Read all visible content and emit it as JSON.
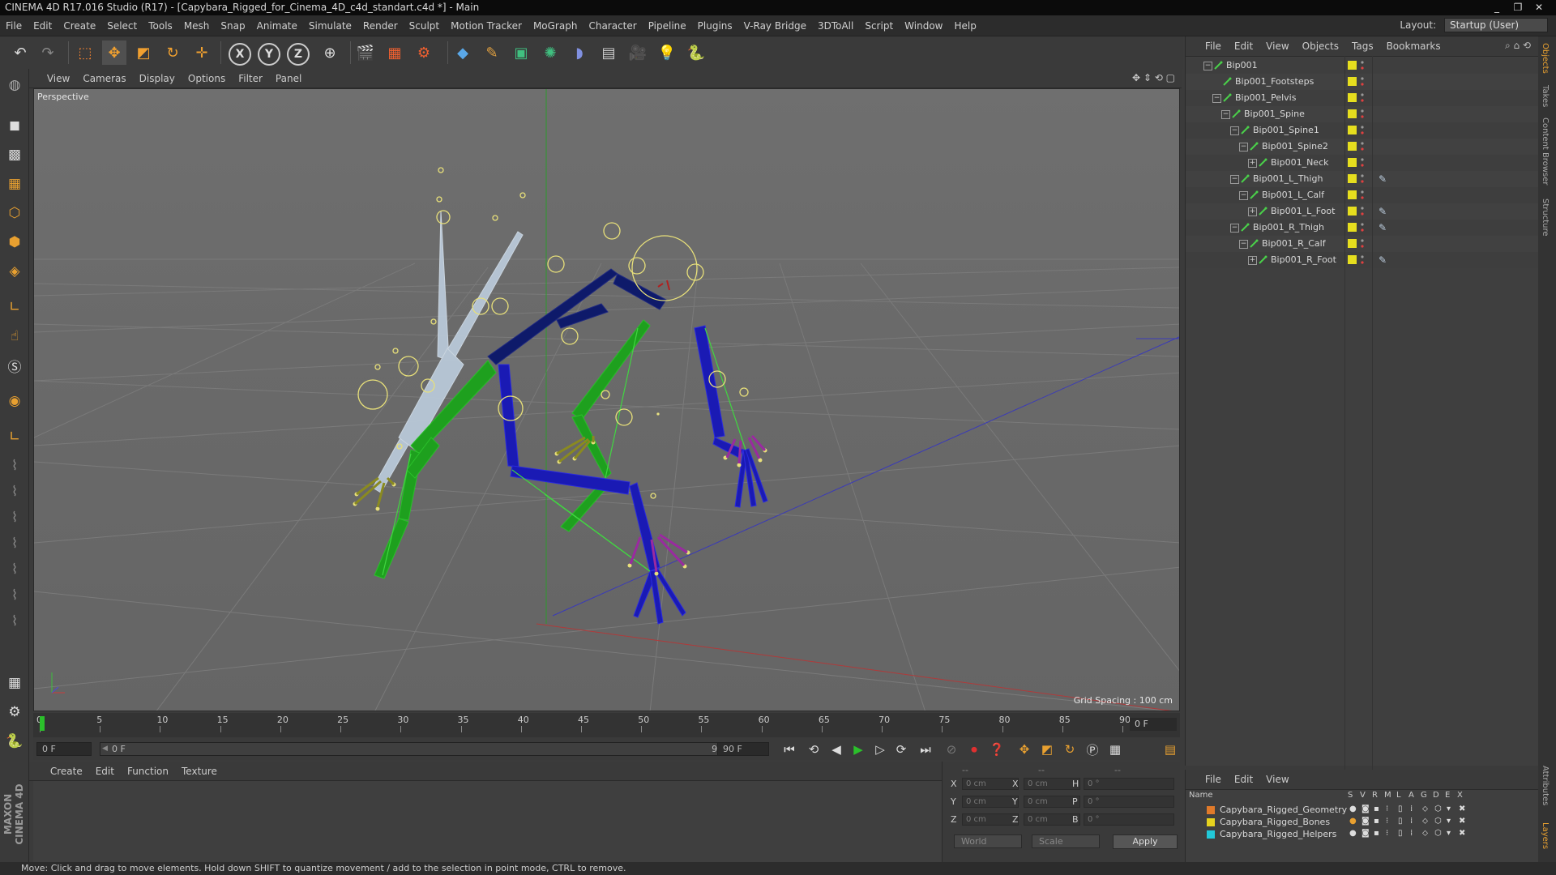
{
  "window": {
    "title": "CINEMA 4D R17.016 Studio (R17) - [Capybara_Rigged_for_Cinema_4D_c4d_standart.c4d *] - Main",
    "buttons": [
      "_",
      "❐",
      "✕"
    ]
  },
  "menubar": {
    "items": [
      "File",
      "Edit",
      "Create",
      "Select",
      "Tools",
      "Mesh",
      "Snap",
      "Animate",
      "Simulate",
      "Render",
      "Sculpt",
      "Motion Tracker",
      "MoGraph",
      "Character",
      "Pipeline",
      "Plugins",
      "V-Ray Bridge",
      "3DToAll",
      "Script",
      "Window",
      "Help"
    ],
    "layout_label": "Layout:",
    "layout_value": "Startup (User)"
  },
  "toolbar": {
    "icons": [
      "undo-icon",
      "redo-icon",
      "live-selection-icon",
      "move-icon",
      "scale-icon",
      "rotate-icon",
      "last-tool-icon",
      "x-axis-icon",
      "y-axis-icon",
      "z-axis-icon",
      "coordinate-system-icon",
      "render-view-icon",
      "render-picture-viewer-icon",
      "edit-render-settings-icon",
      "cube-icon",
      "pen-spline-icon",
      "subdivision-icon",
      "array-icon",
      "deformer-icon",
      "floor-icon",
      "camera-icon",
      "light-icon",
      "python-icon"
    ],
    "axis_labels": [
      "X",
      "Y",
      "Z"
    ]
  },
  "viewport": {
    "menu": [
      "View",
      "Cameras",
      "Display",
      "Options",
      "Filter",
      "Panel"
    ],
    "label": "Perspective",
    "grid_spacing": "Grid Spacing : 100 cm"
  },
  "timeline": {
    "ticks": [
      "0",
      "5",
      "10",
      "15",
      "20",
      "25",
      "30",
      "35",
      "40",
      "45",
      "50",
      "55",
      "60",
      "65",
      "70",
      "75",
      "80",
      "85",
      "90"
    ],
    "current_frame": "0 F"
  },
  "playback": {
    "start_field": "0 F",
    "range_start": "0 F",
    "range_end": "90 F",
    "end_field": "90 F"
  },
  "materials": {
    "menu": [
      "Create",
      "Edit",
      "Function",
      "Texture"
    ]
  },
  "coordinates": {
    "headers": [
      "--",
      "--",
      "--"
    ],
    "rows": [
      {
        "a": "X",
        "av": "0 cm",
        "b": "X",
        "bv": "0 cm",
        "c": "H",
        "cv": "0 °"
      },
      {
        "a": "Y",
        "av": "0 cm",
        "b": "Y",
        "bv": "0 cm",
        "c": "P",
        "cv": "0 °"
      },
      {
        "a": "Z",
        "av": "0 cm",
        "b": "Z",
        "bv": "0 cm",
        "c": "B",
        "cv": "0 °"
      }
    ],
    "space": "World",
    "mode": "Scale",
    "apply": "Apply"
  },
  "object_manager": {
    "menu": [
      "File",
      "Edit",
      "View",
      "Objects",
      "Tags",
      "Bookmarks"
    ],
    "objects": [
      {
        "name": "Bip001",
        "depth": 0,
        "expander": "−",
        "tag": ""
      },
      {
        "name": "Bip001_Footsteps",
        "depth": 1,
        "expander": "",
        "tag": ""
      },
      {
        "name": "Bip001_Pelvis",
        "depth": 1,
        "expander": "−",
        "tag": ""
      },
      {
        "name": "Bip001_Spine",
        "depth": 2,
        "expander": "−",
        "tag": ""
      },
      {
        "name": "Bip001_Spine1",
        "depth": 3,
        "expander": "−",
        "tag": ""
      },
      {
        "name": "Bip001_Spine2",
        "depth": 4,
        "expander": "−",
        "tag": ""
      },
      {
        "name": "Bip001_Neck",
        "depth": 5,
        "expander": "+",
        "tag": ""
      },
      {
        "name": "Bip001_L_Thigh",
        "depth": 3,
        "expander": "−",
        "tag": "ik-tag-icon"
      },
      {
        "name": "Bip001_L_Calf",
        "depth": 4,
        "expander": "−",
        "tag": ""
      },
      {
        "name": "Bip001_L_Foot",
        "depth": 5,
        "expander": "+",
        "tag": "ik-goal-tag-icon"
      },
      {
        "name": "Bip001_R_Thigh",
        "depth": 3,
        "expander": "−",
        "tag": "ik-tag-icon"
      },
      {
        "name": "Bip001_R_Calf",
        "depth": 4,
        "expander": "−",
        "tag": ""
      },
      {
        "name": "Bip001_R_Foot",
        "depth": 5,
        "expander": "+",
        "tag": "ik-goal-tag-icon"
      }
    ]
  },
  "layer_manager": {
    "menu": [
      "File",
      "Edit",
      "View"
    ],
    "name_header": "Name",
    "flag_headers": [
      "S",
      "V",
      "R",
      "M",
      "L",
      "A",
      "G",
      "D",
      "E",
      "X"
    ],
    "layers": [
      {
        "name": "Capybara_Rigged_Geometry",
        "color": "#e07a2a"
      },
      {
        "name": "Capybara_Rigged_Bones",
        "color": "#e6d21e"
      },
      {
        "name": "Capybara_Rigged_Helpers",
        "color": "#22c8d8"
      }
    ]
  },
  "right_tabs": [
    "Objects",
    "Takes",
    "Content Browser",
    "Structure",
    "Attributes",
    "Layers"
  ],
  "left_tools": [
    "make-editable-icon",
    "model-mode-icon",
    "texture-mode-icon",
    "workplane-mode-icon",
    "points-mode-icon",
    "edges-mode-icon",
    "polygons-mode-icon",
    "enable-axis-icon",
    "tweak-mode-icon",
    "solo-icon",
    "snap-icon",
    "locked-workplane-icon",
    "brush-icon",
    "pull-icon",
    "smooth-icon",
    "flatten-icon",
    "inflate-icon",
    "grab-icon",
    "knife-icon",
    "texture-view-icon",
    "python-icon"
  ],
  "branding": "MAXON CINEMA 4D",
  "status": "Move: Click and drag to move elements. Hold down SHIFT to quantize movement / add to the selection in point mode, CTRL to remove.",
  "colors": {
    "bones_yellow": "#e6de1e",
    "spine_light": "#b9c8d8",
    "bone_green": "#1ea01e",
    "bone_blue": "#1a1ab4",
    "bone_navy": "#0e1a6a"
  }
}
